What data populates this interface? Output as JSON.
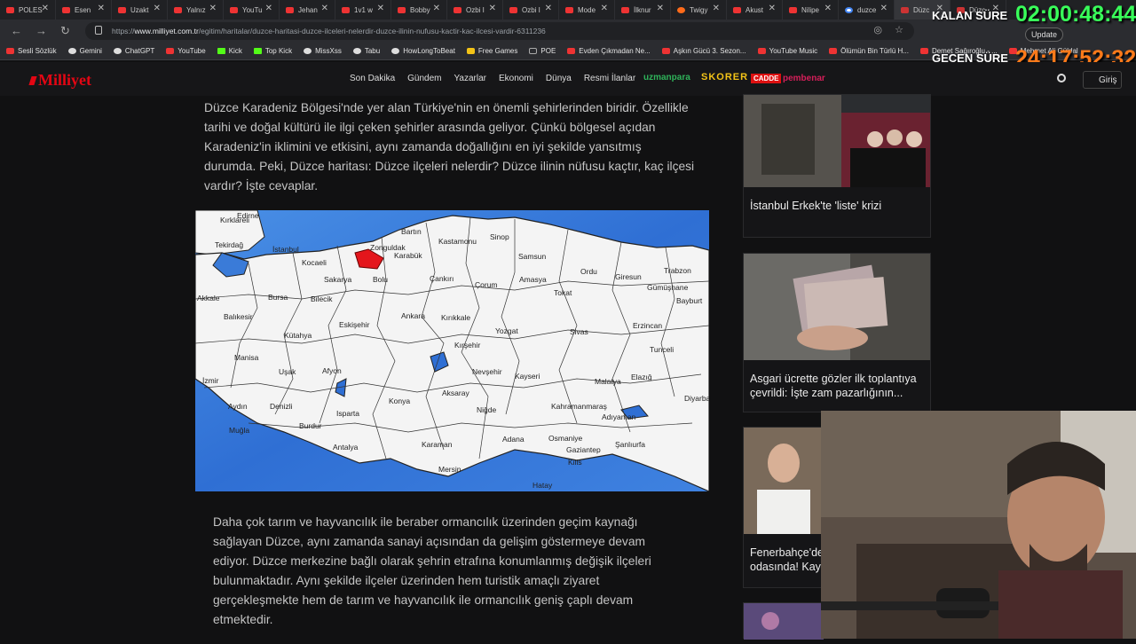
{
  "browser": {
    "tabs": [
      {
        "title": "POLES",
        "favicon": "youtube-icon"
      },
      {
        "title": "Esen",
        "favicon": "youtube-icon"
      },
      {
        "title": "Uzakt",
        "favicon": "youtube-icon"
      },
      {
        "title": "Yalnız",
        "favicon": "youtube-icon"
      },
      {
        "title": "YouTu",
        "favicon": "youtube-icon"
      },
      {
        "title": "Jehan",
        "favicon": "youtube-icon"
      },
      {
        "title": "1v1 w",
        "favicon": "youtube-icon"
      },
      {
        "title": "Bobby",
        "favicon": "youtube-icon"
      },
      {
        "title": "Ozbi I",
        "favicon": "youtube-icon"
      },
      {
        "title": "Ozbi I",
        "favicon": "youtube-icon"
      },
      {
        "title": "Mode",
        "favicon": "youtube-icon"
      },
      {
        "title": "İlknur",
        "favicon": "youtube-icon"
      },
      {
        "title": "Twigy",
        "favicon": "opera-icon"
      },
      {
        "title": "Akust",
        "favicon": "youtube-icon"
      },
      {
        "title": "Nilipe",
        "favicon": "youtube-icon"
      },
      {
        "title": "duzce",
        "favicon": "google-icon"
      },
      {
        "title": "Düzc",
        "favicon": "milliyet-icon"
      },
      {
        "title": "Düzc",
        "favicon": "milliyet-icon"
      }
    ],
    "url_prefix": "https://",
    "url_domain": "www.milliyet.com.tr",
    "url_path": "/egitim/haritalar/duzce-haritasi-duzce-ilceleri-nelerdir-duzce-ilinin-nufusu-kactir-kac-ilcesi-vardir-6311236",
    "update_label": "Update",
    "bookmarks": [
      {
        "label": "Sesli Sözlük",
        "icon": "flag-icon"
      },
      {
        "label": "Gemini",
        "icon": "gemini-icon"
      },
      {
        "label": "ChatGPT",
        "icon": "chatgpt-icon"
      },
      {
        "label": "YouTube",
        "icon": "youtube-icon"
      },
      {
        "label": "Kick",
        "icon": "kick-icon"
      },
      {
        "label": "Top Kick",
        "icon": "kick-icon"
      },
      {
        "label": "MissXss",
        "icon": "star-icon"
      },
      {
        "label": "Tabu",
        "icon": "cp-icon"
      },
      {
        "label": "HowLongToBeat",
        "icon": "hltb-icon"
      },
      {
        "label": "Free Games",
        "icon": "tag-icon"
      },
      {
        "label": "POE",
        "icon": "folder-icon"
      },
      {
        "label": "Evden Çıkmadan Ne...",
        "icon": "youtube-icon"
      },
      {
        "label": "Aşkın Gücü 3. Sezon...",
        "icon": "youtube-icon"
      },
      {
        "label": "YouTube Music",
        "icon": "youtube-icon"
      },
      {
        "label": "Ölümün Bin Türlü H...",
        "icon": "youtube-icon"
      },
      {
        "label": "Demet Sağıroğlu - ...",
        "icon": "youtube-icon"
      },
      {
        "label": "Mehmet Ali Güldal",
        "icon": "youtube-icon"
      }
    ]
  },
  "overlay": {
    "kalan_label": "KALAN SÜRE",
    "kalan_time": "02:00:48:44",
    "gecen_label": "GEÇEN SÜRE",
    "gecen_time": "24:17:52:32"
  },
  "site": {
    "logo": "Milliyet",
    "nav": [
      "Son Dakika",
      "Gündem",
      "Yazarlar",
      "Ekonomi",
      "Dünya",
      "Resmi İlanlar"
    ],
    "partners": [
      "uzmanpara",
      "SKORER",
      "CADDE",
      "pembenar"
    ],
    "login_label": "Giriş"
  },
  "article": {
    "paragraph1_lines": [
      "Düzce Karadeniz Bölgesi'nde yer alan Türkiye'nin en önemli şehirlerinden biridir. Özellikle",
      "tarihi ve doğal kültürü ile ilgi çeken şehirler arasında geliyor. Çünkü bölgesel açıdan",
      "Karadeniz'in iklimini ve etkisini, aynı zamanda doğallığını en iyi şekilde yansıtmış",
      "durumda. Peki, Düzce haritası: Düzce ilçeleri nelerdir? Düzce ilinin nüfusu kaçtır, kaç ilçesi",
      "vardır? İşte cevaplar."
    ],
    "paragraph2_lines": [
      "Daha çok tarım ve hayvancılık ile beraber ormancılık üzerinden geçim kaynağı",
      "sağlayan Düzce, aynı zamanda sanayi açısından da gelişim göstermeye devam",
      "ediyor. Düzce merkezine bağlı olarak şehrin etrafına konumlanmış değişik ilçeleri",
      "bulunmaktadır. Aynı şekilde ilçeler üzerinden hem turistik amaçlı ziyaret",
      "gerçekleşmekte hem de tarım ve hayvancılık ile ormancılık geniş çaplı devam",
      "etmektedir."
    ],
    "map_labels": [
      "Kırklareli",
      "Edirne",
      "Tekirdağ",
      "İstanbul",
      "Kocaeli",
      "Sakarya",
      "Zonguldak",
      "Bartın",
      "Karabük",
      "Kastamonu",
      "Sinop",
      "Samsun",
      "Ordu",
      "Giresun",
      "Trabzon",
      "Gümüşhane",
      "Bayburt",
      "Akkale",
      "Bursa",
      "Bilecik",
      "Bolu",
      "Çankırı",
      "Çorum",
      "Amasya",
      "Tokat",
      "Balıkesir",
      "Eskişehir",
      "Ankara",
      "Kırıkkale",
      "Yozgat",
      "Sivas",
      "Erzincan",
      "Tunceli",
      "Kütahya",
      "Kırşehir",
      "Manisa",
      "Uşak",
      "Afyon",
      "Nevşehir",
      "Kayseri",
      "Malatya",
      "Elazığ",
      "İzmir",
      "Aydın",
      "Denizli",
      "Burdur",
      "Isparta",
      "Konya",
      "Aksaray",
      "Niğde",
      "Kahramanmaraş",
      "Adıyaman",
      "Diyarbakır",
      "Muğla",
      "Antalya",
      "Karaman",
      "Adana",
      "Osmaniye",
      "Gaziantep",
      "Kilis",
      "Şanlıurfa",
      "Mersin",
      "Hatay"
    ]
  },
  "sidebar": {
    "cards": [
      {
        "caption_lines": [
          "İstanbul Erkek'te 'liste' krizi"
        ]
      },
      {
        "caption_lines": [
          "Asgari ücrette gözler ilk toplantıya",
          "çevrildi: İşte zam pazarlığının..."
        ]
      },
      {
        "caption_lines": [
          "Fenerbahçe'de",
          "odasında! Kayı"
        ]
      }
    ]
  },
  "colors": {
    "brand": "#e30613",
    "background": "#111112",
    "accent_timer": "#39ff5a",
    "accent_elapsed": "#ff7a1a"
  }
}
